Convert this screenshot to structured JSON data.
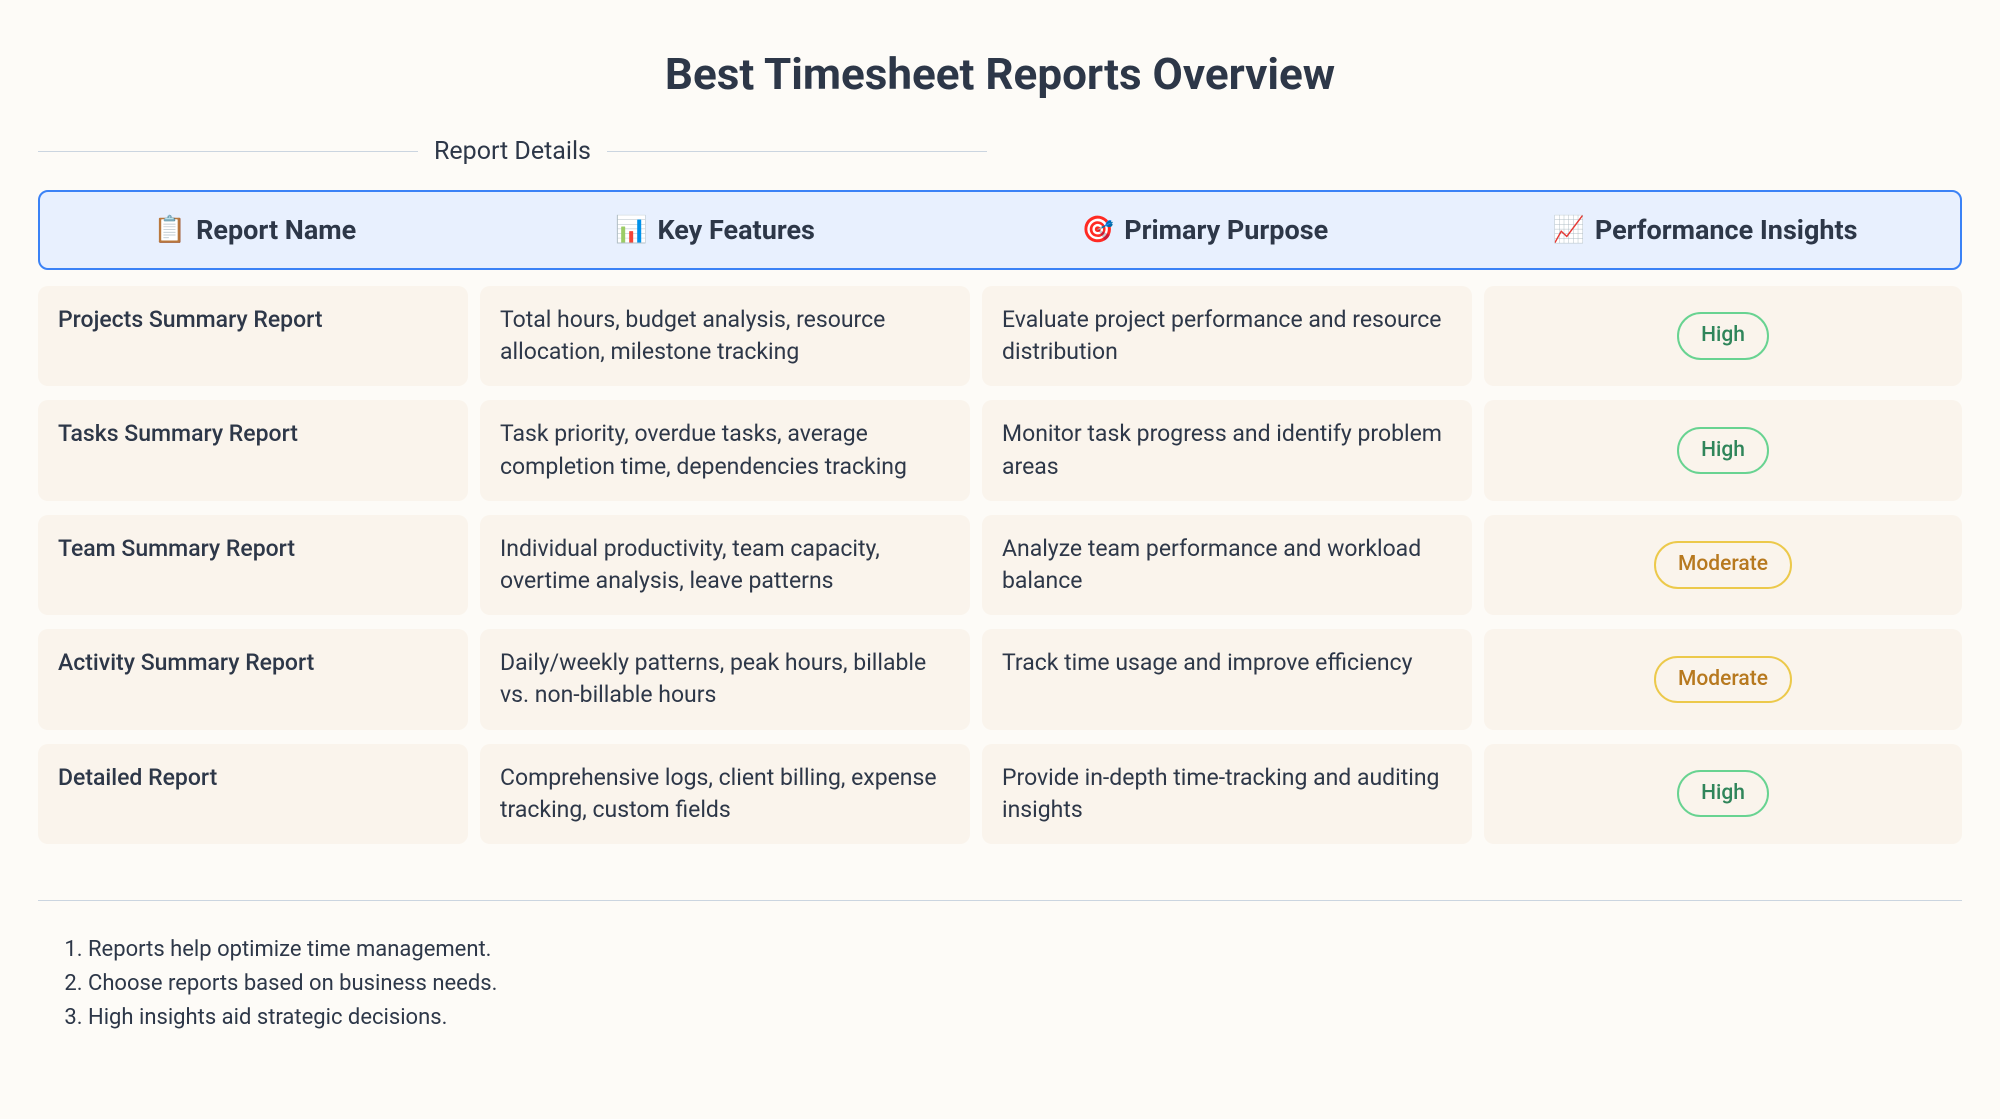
{
  "title": "Best Timesheet Reports Overview",
  "fieldset_label": "Report Details",
  "columns": [
    {
      "icon": "📋",
      "label": "Report Name"
    },
    {
      "icon": "📊",
      "label": "Key Features"
    },
    {
      "icon": "🎯",
      "label": "Primary Purpose"
    },
    {
      "icon": "📈",
      "label": "Performance Insights"
    }
  ],
  "rows": [
    {
      "name": "Projects Summary Report",
      "features": "Total hours, budget analysis, resource allocation, milestone tracking",
      "purpose": "Evaluate project performance and resource distribution",
      "insight": "High",
      "insight_level": "high"
    },
    {
      "name": "Tasks Summary Report",
      "features": "Task priority, overdue tasks, average completion time, dependencies tracking",
      "purpose": "Monitor task progress and identify problem areas",
      "insight": "High",
      "insight_level": "high"
    },
    {
      "name": "Team Summary Report",
      "features": "Individual productivity, team capacity, overtime analysis, leave patterns",
      "purpose": "Analyze team performance and workload balance",
      "insight": "Moderate",
      "insight_level": "moderate"
    },
    {
      "name": "Activity Summary Report",
      "features": "Daily/weekly patterns, peak hours, billable vs. non-billable hours",
      "purpose": "Track time usage and improve efficiency",
      "insight": "Moderate",
      "insight_level": "moderate"
    },
    {
      "name": "Detailed Report",
      "features": "Comprehensive logs, client billing, expense tracking, custom fields",
      "purpose": "Provide in-depth time-tracking and auditing insights",
      "insight": "High",
      "insight_level": "high"
    }
  ],
  "footnotes": [
    "Reports help optimize time management.",
    "Choose reports based on business needs.",
    "High insights aid strategic decisions."
  ]
}
